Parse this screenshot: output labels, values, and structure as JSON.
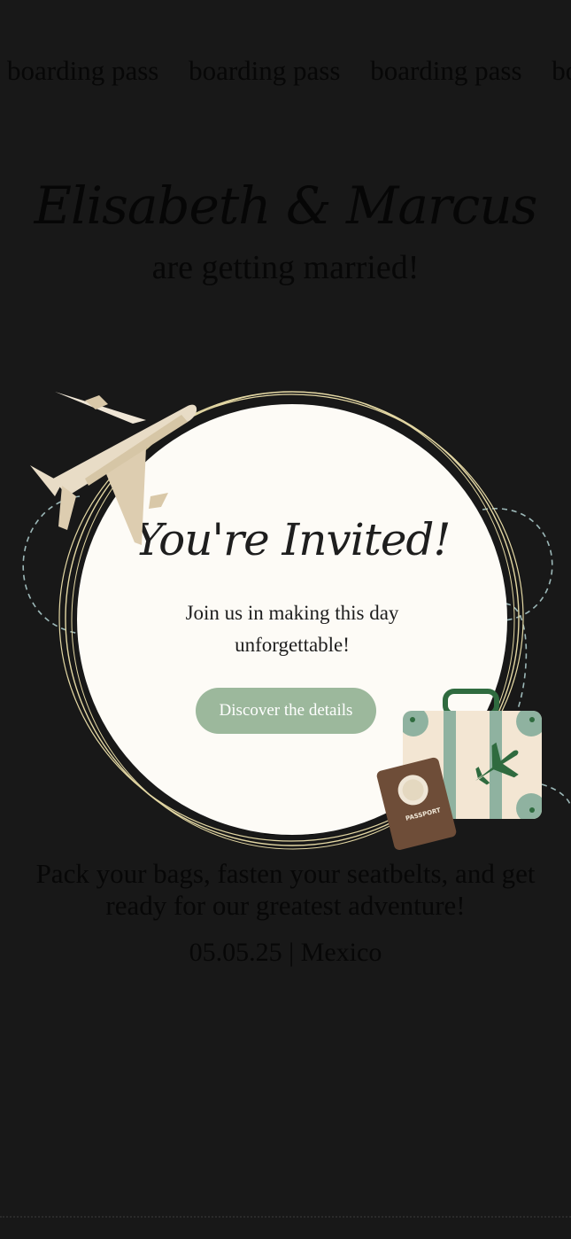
{
  "marquee": [
    "boarding pass",
    "boarding pass",
    "boarding pass",
    "boarding pass"
  ],
  "hero": {
    "couple": "Elisabeth & Marcus",
    "subtitle": "are getting married!"
  },
  "background_section": {
    "heading": "You",
    "text": "Pack your bags, fasten your seatbelts, and get ready for our greatest adventure!",
    "date_location": "05.05.25 | Mexico"
  },
  "modal": {
    "title": "You're Invited!",
    "message": "Join us in making this day unforgettable!",
    "button_label": "Discover the details",
    "passport_label": "PASSPORT"
  },
  "colors": {
    "page_bg": "#181818",
    "modal_bg": "#fdfbf6",
    "button_bg": "#9cb89c",
    "plane": "#e8dcc6",
    "suitcase_accent": "#8fb2a0",
    "passport": "#6e4d38",
    "ring": "#e4d8a4",
    "dashed_path": "#9cb8b8"
  },
  "icons": {
    "plane": "airplane-illustration",
    "suitcase": "suitcase-illustration",
    "passport": "passport-illustration"
  }
}
